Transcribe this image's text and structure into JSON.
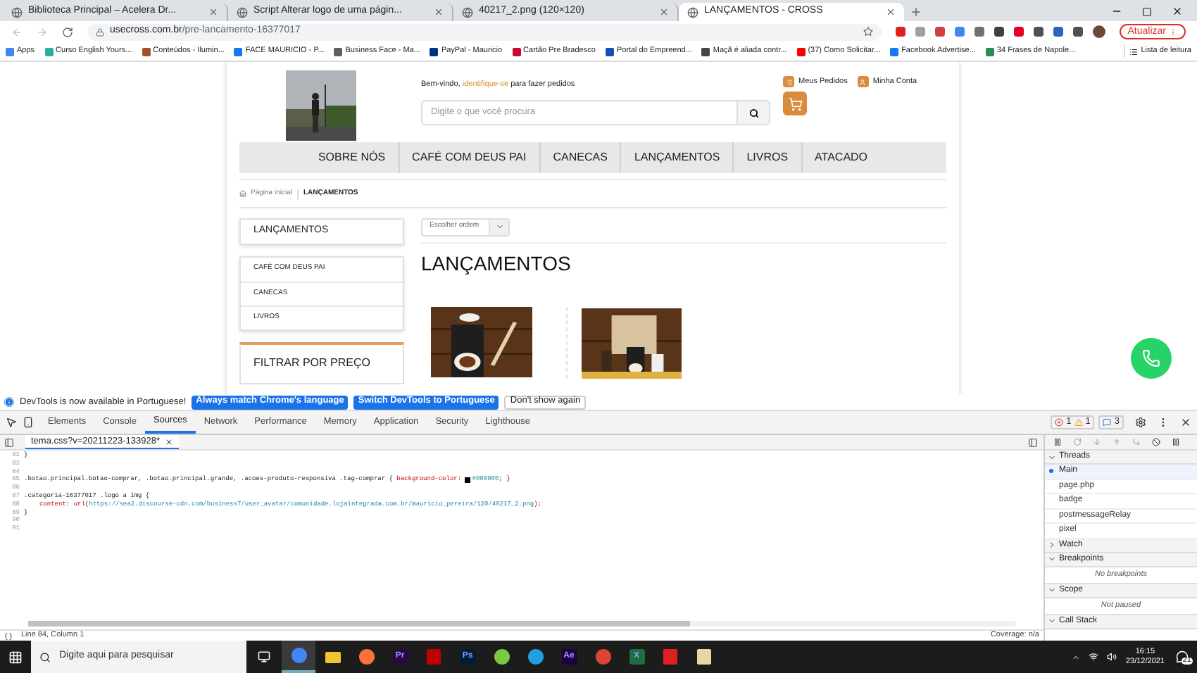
{
  "browser": {
    "tabs": [
      {
        "title": "Biblioteca Principal – Acelera Dr...",
        "selected": false
      },
      {
        "title": "Script Alterar logo de uma págin...",
        "selected": false
      },
      {
        "title": "40217_2.png (120×120)",
        "selected": false
      },
      {
        "title": "LANÇAMENTOS - CROSS",
        "selected": true
      }
    ],
    "url": {
      "host": "usecross.com.br",
      "path": "/pre-lancamento-16377017"
    },
    "update_button": "Atualizar",
    "bookmarks": [
      {
        "label": "Apps",
        "color": "#4285f4"
      },
      {
        "label": "Curso English Yours...",
        "color": "#2bb0a0"
      },
      {
        "label": "Conteúdos - Ilumin...",
        "color": "#a0522d"
      },
      {
        "label": "FACE MAURICIO - P...",
        "color": "#1877f2"
      },
      {
        "label": "Business Face - Ma...",
        "color": "#606060"
      },
      {
        "label": "PayPal - Mauricio",
        "color": "#003087"
      },
      {
        "label": "Cartão Pre Bradesco",
        "color": "#cc092f"
      },
      {
        "label": "Portal do Empreend...",
        "color": "#1351b4"
      },
      {
        "label": "Maçã é aliada contr...",
        "color": "#444444"
      },
      {
        "label": "(37) Como Solicitar...",
        "color": "#ff0000"
      },
      {
        "label": "Facebook Advertise...",
        "color": "#1877f2"
      },
      {
        "label": "34 Frases de Napole...",
        "color": "#2e8b57"
      }
    ],
    "reading_list": "Lista de leitura"
  },
  "site": {
    "welcome": {
      "prefix": "Bem-vindo, ",
      "link": "identifique-se",
      "suffix": " para fazer pedidos"
    },
    "search_placeholder": "Digite o que você procura",
    "account_links": [
      "Meus Pedidos",
      "Minha Conta"
    ],
    "nav": [
      "SOBRE NÓS",
      "CAFÉ COM DEUS PAI",
      "CANECAS",
      "LANÇAMENTOS",
      "LIVROS",
      "ATACADO"
    ],
    "breadcrumb": [
      "Página inicial",
      "LANÇAMENTOS"
    ],
    "sidebar_title": "LANÇAMENTOS",
    "categories": [
      "CAFÉ COM DEUS PAI",
      "CANECAS",
      "LIVROS"
    ],
    "filter_title": "FILTRAR POR PREÇO",
    "sort": "Escolher ordem",
    "heading": "LANÇAMENTOS"
  },
  "devtools": {
    "infobar": {
      "message": "DevTools is now available in Portuguese!",
      "buttons": [
        {
          "label": "Always match Chrome's language",
          "kind": "primary"
        },
        {
          "label": "Switch DevTools to Portuguese",
          "kind": "primary"
        },
        {
          "label": "Don't show again",
          "kind": "plain"
        }
      ]
    },
    "tabs": [
      {
        "label": "Elements",
        "selected": false
      },
      {
        "label": "Console",
        "selected": false
      },
      {
        "label": "Sources",
        "selected": true
      },
      {
        "label": "Network",
        "selected": false
      },
      {
        "label": "Performance",
        "selected": false
      },
      {
        "label": "Memory",
        "selected": false
      },
      {
        "label": "Application",
        "selected": false
      },
      {
        "label": "Security",
        "selected": false
      },
      {
        "label": "Lighthouse",
        "selected": false
      }
    ],
    "counts": {
      "errors": "1",
      "warnings": "1",
      "messages": "3"
    },
    "file_tab": "tema.css?v=20211223-133928*",
    "code": [
      {
        "num": "82",
        "segments": [
          {
            "kind": "plain",
            "text": "}"
          }
        ]
      },
      {
        "num": "83"
      },
      {
        "num": "84"
      },
      {
        "num": "85",
        "segments": [
          {
            "kind": "plain",
            "text": ".botao.principal.botao-comprar, .botao.principal.grande, .acoes-produto-responsiva .tag-comprar { "
          },
          {
            "kind": "prop",
            "text": "background-color"
          },
          {
            "kind": "plain",
            "text": ": "
          },
          {
            "kind": "swatch",
            "color": "#000000"
          },
          {
            "kind": "value",
            "text": "#000000"
          },
          {
            "kind": "plain",
            "text": "; }"
          }
        ]
      },
      {
        "num": "86"
      },
      {
        "num": "87",
        "segments": [
          {
            "kind": "plain",
            "text": ".categoria-16377017 .logo a img {"
          }
        ]
      },
      {
        "num": "88",
        "segments": [
          {
            "kind": "indent"
          },
          {
            "kind": "prop",
            "text": "content"
          },
          {
            "kind": "plain",
            "text": ": "
          },
          {
            "kind": "func",
            "text": "url("
          },
          {
            "kind": "value",
            "text": "https://sea2.discourse-cdn.com/business7/user_avatar/comunidade.lojaintegrada.com.br/mauricio_pereira/120/40217_2.png"
          },
          {
            "kind": "func",
            "text": ")"
          },
          {
            "kind": "plain",
            "text": ";"
          }
        ]
      },
      {
        "num": "89",
        "segments": [
          {
            "kind": "plain",
            "text": "}"
          }
        ]
      },
      {
        "num": "90"
      },
      {
        "num": "91"
      }
    ],
    "status": "Line 84, Column 1",
    "coverage": "Coverage: n/a",
    "sections": [
      {
        "title": "Threads",
        "expanded": true,
        "items": [
          {
            "label": "Main",
            "selected": true
          },
          {
            "label": "page.php",
            "selected": false
          },
          {
            "label": "badge",
            "selected": false
          },
          {
            "label": "postmessageRelay",
            "selected": false
          },
          {
            "label": "pixel",
            "selected": false
          }
        ]
      },
      {
        "title": "Watch",
        "expanded": false
      },
      {
        "title": "Breakpoints",
        "expanded": true,
        "note": "No breakpoints"
      },
      {
        "title": "Scope",
        "expanded": true,
        "note": "Not paused"
      },
      {
        "title": "Call Stack",
        "expanded": true
      }
    ]
  },
  "taskbar": {
    "search": "Digite aqui para pesquisar",
    "apps": [
      {
        "kind": "chrome",
        "color": "#4285f4",
        "selected": true
      },
      {
        "kind": "folder",
        "color": "#f4c430",
        "selected": false
      },
      {
        "kind": "firefox",
        "color": "#ff7139",
        "selected": false
      },
      {
        "kind": "label",
        "label": "Pr",
        "color": "#2a0845",
        "selected": false
      },
      {
        "kind": "filezilla",
        "color": "#bf0000",
        "selected": false
      },
      {
        "kind": "label",
        "label": "Ps",
        "color": "#001e36",
        "selected": false
      },
      {
        "kind": "circle",
        "color": "#7ac943",
        "selected": false
      },
      {
        "kind": "edge",
        "color": "#1fa0e0",
        "selected": false
      },
      {
        "kind": "label",
        "label": "Ae",
        "color": "#1f0040",
        "selected": false
      },
      {
        "kind": "chrome",
        "color": "#db4437",
        "selected": false
      },
      {
        "kind": "label",
        "label": "X",
        "color": "#1d6f42",
        "selected": false
      },
      {
        "kind": "pdf",
        "color": "#e02020",
        "selected": false
      },
      {
        "kind": "notes",
        "color": "#e8d8a0",
        "selected": false
      }
    ],
    "time": "16:15",
    "date": "23/12/2021",
    "notifications": "21"
  }
}
